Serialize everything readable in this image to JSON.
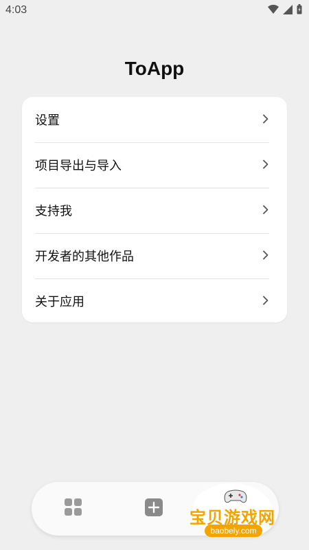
{
  "status_bar": {
    "time": "4:03"
  },
  "app": {
    "title": "ToApp"
  },
  "menu": {
    "items": [
      {
        "label": "设置"
      },
      {
        "label": "项目导出与导入"
      },
      {
        "label": "支持我"
      },
      {
        "label": "开发者的其他作品"
      },
      {
        "label": "关于应用"
      }
    ]
  },
  "bottom_nav": {
    "icons": [
      "grid-icon",
      "add-square-icon"
    ]
  },
  "watermark": {
    "text": "宝贝游戏网",
    "url": "baobely.com"
  },
  "colors": {
    "background": "#efefef",
    "card": "#ffffff",
    "accent_watermark": "#f2a500"
  }
}
